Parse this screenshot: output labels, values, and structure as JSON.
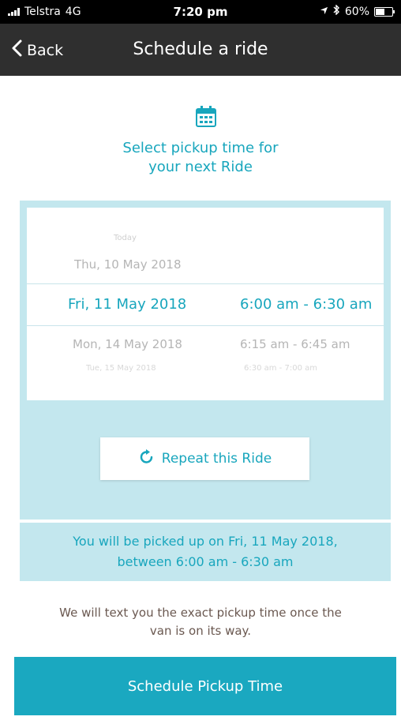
{
  "status_bar": {
    "carrier": "Telstra",
    "network": "4G",
    "time": "7:20 pm",
    "battery": "60%",
    "battery_level": 0.6
  },
  "nav": {
    "back_label": "Back",
    "title": "Schedule a ride"
  },
  "heading": {
    "line1": "Select pickup time for",
    "line2": "your next Ride"
  },
  "picker": {
    "today_label": "Today",
    "prev_date": "Thu, 10 May 2018",
    "selected_date": "Fri, 11 May 2018",
    "selected_time": "6:00 am - 6:30 am",
    "next_date": "Mon, 14 May 2018",
    "next_time": "6:15 am - 6:45 am",
    "next2_date": "Tue, 15 May 2018",
    "next2_time": "6:30 am - 7:00 am"
  },
  "repeat_button": {
    "label": "Repeat this Ride"
  },
  "summary": {
    "line1": "You will be picked up on Fri, 11 May 2018,",
    "line2": "between 6:00 am - 6:30 am"
  },
  "note": {
    "line1": "We will text you the exact pickup time once the",
    "line2": "van is on its way."
  },
  "cta": {
    "label": "Schedule Pickup Time"
  },
  "colors": {
    "accent": "#1aa8c0",
    "panel": "#c3e7ee",
    "navbar": "#2f2f2f"
  }
}
